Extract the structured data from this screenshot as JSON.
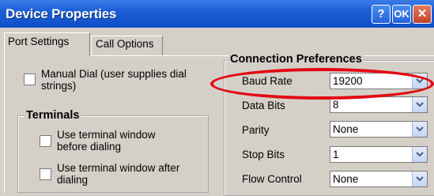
{
  "window": {
    "title": "Device Properties",
    "help_label": "?",
    "ok_label": "OK",
    "close_label": "✕"
  },
  "tabs": [
    {
      "label": "Port Settings"
    },
    {
      "label": "Call Options"
    }
  ],
  "manual_dial": {
    "line1": "Manual Dial (user supplies dial",
    "line2": "strings)"
  },
  "terminals": {
    "heading": "Terminals",
    "before": {
      "line1": "Use terminal window",
      "line2": "before dialing"
    },
    "after": {
      "line1": "Use terminal window after",
      "line2": "dialing"
    }
  },
  "connection": {
    "heading": "Connection Preferences",
    "rows": [
      {
        "label": "Baud Rate",
        "value": "19200"
      },
      {
        "label": "Data Bits",
        "value": "8"
      },
      {
        "label": "Parity",
        "value": "None"
      },
      {
        "label": "Stop Bits",
        "value": "1"
      },
      {
        "label": "Flow Control",
        "value": "None"
      }
    ]
  },
  "highlight_color": "#e30613",
  "titlebar_color": "#1c5fd6"
}
